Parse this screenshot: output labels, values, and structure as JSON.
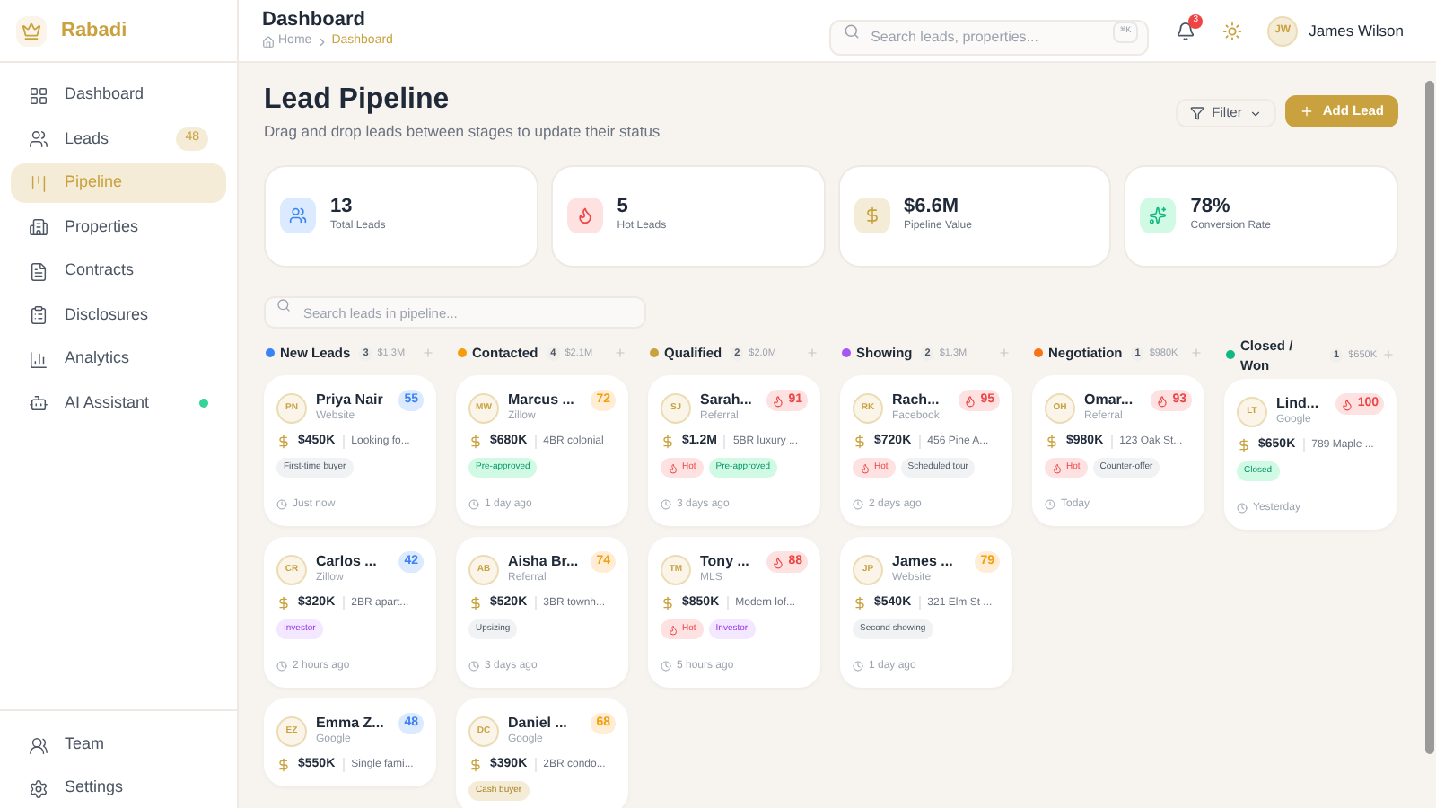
{
  "brand": {
    "name": "Rabadi"
  },
  "sidebar": {
    "items": [
      {
        "label": "Dashboard",
        "selected": false
      },
      {
        "label": "Leads",
        "selected": false,
        "badge": "48"
      },
      {
        "label": "Pipeline",
        "selected": true
      },
      {
        "label": "Properties",
        "selected": false
      },
      {
        "label": "Contracts",
        "selected": false
      },
      {
        "label": "Disclosures",
        "selected": false
      },
      {
        "label": "Analytics",
        "selected": false
      },
      {
        "label": "AI Assistant",
        "selected": false,
        "online": true
      }
    ],
    "bottom_items": [
      {
        "label": "Team",
        "selected": false
      },
      {
        "label": "Settings",
        "selected": false
      }
    ]
  },
  "header": {
    "title": "Dashboard",
    "breadcrumb": [
      "Home",
      "Dashboard"
    ],
    "search": {
      "placeholder": "Search leads, properties...",
      "shortcut": "⌘K"
    },
    "notifications": "3",
    "user": {
      "initials": "JW",
      "name": "James Wilson"
    }
  },
  "page": {
    "title": "Lead Pipeline",
    "subtitle": "Drag and drop leads between stages to update their status",
    "filter": "Filter",
    "add": "Add Lead"
  },
  "stats": [
    {
      "value": "13",
      "label": "Total Leads",
      "kind": "users"
    },
    {
      "value": "5",
      "label": "Hot Leads",
      "kind": "flame"
    },
    {
      "value": "$6.6M",
      "label": "Pipeline Value",
      "kind": "dollar"
    },
    {
      "value": "78%",
      "label": "Conversion Rate",
      "kind": "sparkles"
    }
  ],
  "pipeline_search": {
    "placeholder": "Search leads in pipeline..."
  },
  "columns": [
    {
      "title": "New Leads",
      "color": "#3b82f6",
      "count": "3",
      "value": "$1.3M",
      "cards": [
        {
          "initials": "PN",
          "name": "Priya Nair",
          "source": "Website",
          "score": {
            "value": "55",
            "kind": "cool"
          },
          "price": "$450K",
          "desc": "Looking fo...",
          "tags": [
            {
              "label": "First-time buyer",
              "kind": "gray"
            }
          ],
          "time": "Just now"
        },
        {
          "initials": "CR",
          "name": "Carlos ...",
          "source": "Zillow",
          "score": {
            "value": "42",
            "kind": "cool"
          },
          "price": "$320K",
          "desc": "2BR apart...",
          "tags": [
            {
              "label": "Investor",
              "kind": "purple"
            }
          ],
          "time": "2 hours ago"
        },
        {
          "initials": "EZ",
          "name": "Emma Z...",
          "source": "Google",
          "score": {
            "value": "48",
            "kind": "cool"
          },
          "price": "$550K",
          "desc": "Single fami..."
        }
      ]
    },
    {
      "title": "Contacted",
      "color": "#f59e0b",
      "count": "4",
      "value": "$2.1M",
      "cards": [
        {
          "initials": "MW",
          "name": "Marcus ...",
          "source": "Zillow",
          "score": {
            "value": "72",
            "kind": "warm"
          },
          "price": "$680K",
          "desc": "4BR colonial",
          "tags": [
            {
              "label": "Pre-approved",
              "kind": "green"
            }
          ],
          "time": "1 day ago"
        },
        {
          "initials": "AB",
          "name": "Aisha Br...",
          "source": "Referral",
          "score": {
            "value": "74",
            "kind": "warm"
          },
          "price": "$520K",
          "desc": "3BR townh...",
          "tags": [
            {
              "label": "Upsizing",
              "kind": "gray"
            }
          ],
          "time": "3 days ago"
        },
        {
          "initials": "DC",
          "name": "Daniel ...",
          "source": "Google",
          "score": {
            "value": "68",
            "kind": "warm"
          },
          "price": "$390K",
          "desc": "2BR condo...",
          "tags": [
            {
              "label": "Cash buyer",
              "kind": "amber"
            }
          ]
        }
      ]
    },
    {
      "title": "Qualified",
      "color": "#c9a23f",
      "count": "2",
      "value": "$2.0M",
      "cards": [
        {
          "initials": "SJ",
          "name": "Sarah...",
          "source": "Referral",
          "score": {
            "value": "91",
            "kind": "hot"
          },
          "price": "$1.2M",
          "desc": "5BR luxury ...",
          "tags": [
            {
              "label": "Hot",
              "kind": "hot"
            },
            {
              "label": "Pre-approved",
              "kind": "green"
            }
          ],
          "time": "3 days ago"
        },
        {
          "initials": "TM",
          "name": "Tony ...",
          "source": "MLS",
          "score": {
            "value": "88",
            "kind": "hot"
          },
          "price": "$850K",
          "desc": "Modern lof...",
          "tags": [
            {
              "label": "Hot",
              "kind": "hot"
            },
            {
              "label": "Investor",
              "kind": "purple"
            }
          ],
          "time": "5 hours ago"
        }
      ]
    },
    {
      "title": "Showing",
      "color": "#a855f7",
      "count": "2",
      "value": "$1.3M",
      "cards": [
        {
          "initials": "RK",
          "name": "Rach...",
          "source": "Facebook",
          "score": {
            "value": "95",
            "kind": "hot"
          },
          "price": "$720K",
          "desc": "456 Pine A...",
          "tags": [
            {
              "label": "Hot",
              "kind": "hot"
            },
            {
              "label": "Scheduled tour",
              "kind": "gray"
            }
          ],
          "time": "2 days ago"
        },
        {
          "initials": "JP",
          "name": "James ...",
          "source": "Website",
          "score": {
            "value": "79",
            "kind": "warm"
          },
          "price": "$540K",
          "desc": "321 Elm St ...",
          "tags": [
            {
              "label": "Second showing",
              "kind": "gray"
            }
          ],
          "time": "1 day ago"
        }
      ]
    },
    {
      "title": "Negotiation",
      "color": "#f97316",
      "count": "1",
      "value": "$980K",
      "cards": [
        {
          "initials": "OH",
          "name": "Omar...",
          "source": "Referral",
          "score": {
            "value": "93",
            "kind": "hot"
          },
          "price": "$980K",
          "desc": "123 Oak St...",
          "tags": [
            {
              "label": "Hot",
              "kind": "hot"
            },
            {
              "label": "Counter-offer",
              "kind": "gray"
            }
          ],
          "time": "Today"
        }
      ]
    },
    {
      "title": "Closed / Won",
      "color": "#10b981",
      "count": "1",
      "value": "$650K",
      "cards": [
        {
          "initials": "LT",
          "name": "Lind...",
          "source": "Google",
          "score": {
            "value": "100",
            "kind": "hot"
          },
          "price": "$650K",
          "desc": "789 Maple ...",
          "tags": [
            {
              "label": "Closed",
              "kind": "green"
            }
          ],
          "time": "Yesterday"
        }
      ]
    }
  ]
}
